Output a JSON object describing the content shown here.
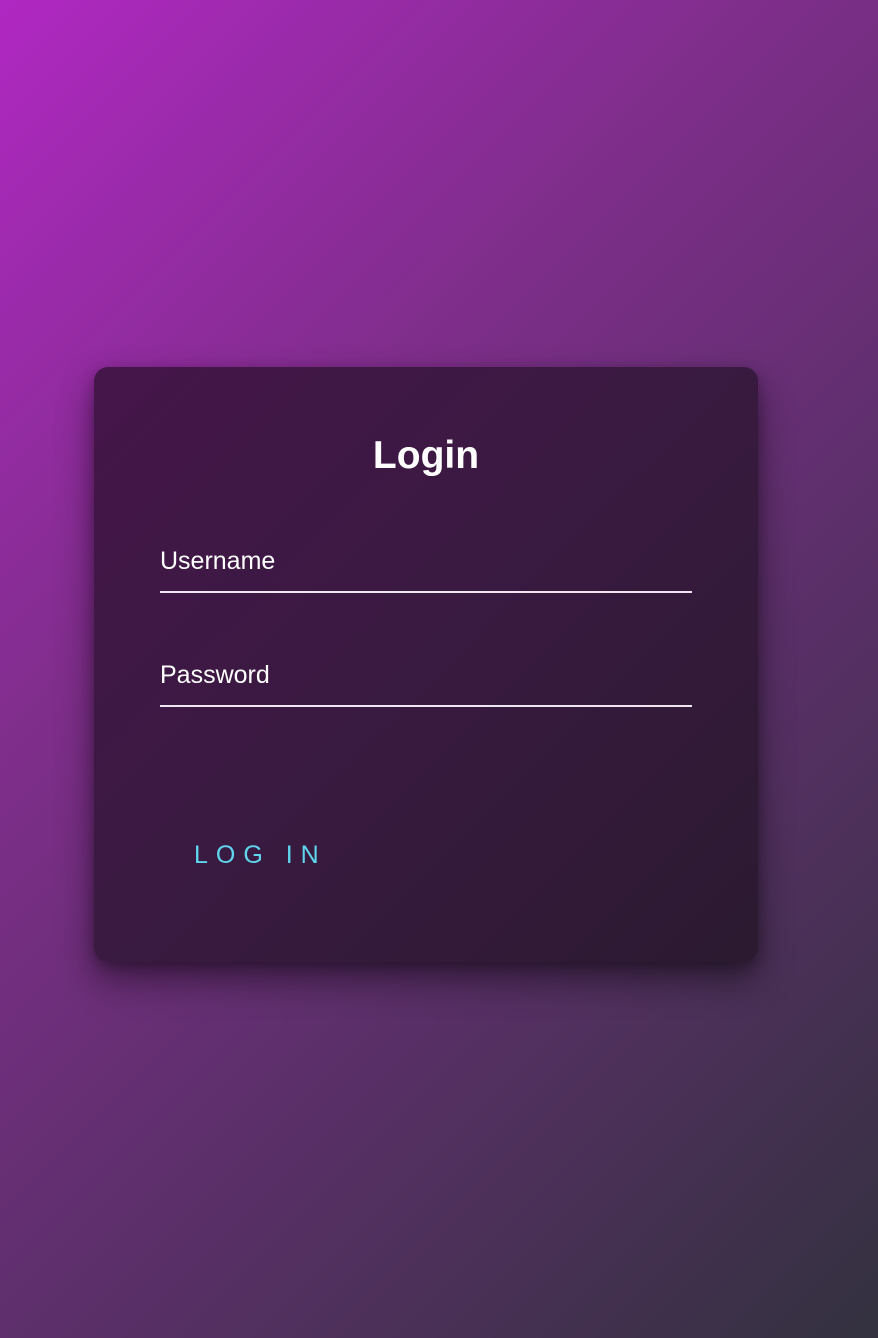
{
  "colors": {
    "accent": "#5fd6ee",
    "text": "#ffffff",
    "card": "#3a1a40"
  },
  "login": {
    "title": "Login",
    "username_label": "Username",
    "password_label": "Password",
    "button_label": "LOG IN"
  }
}
